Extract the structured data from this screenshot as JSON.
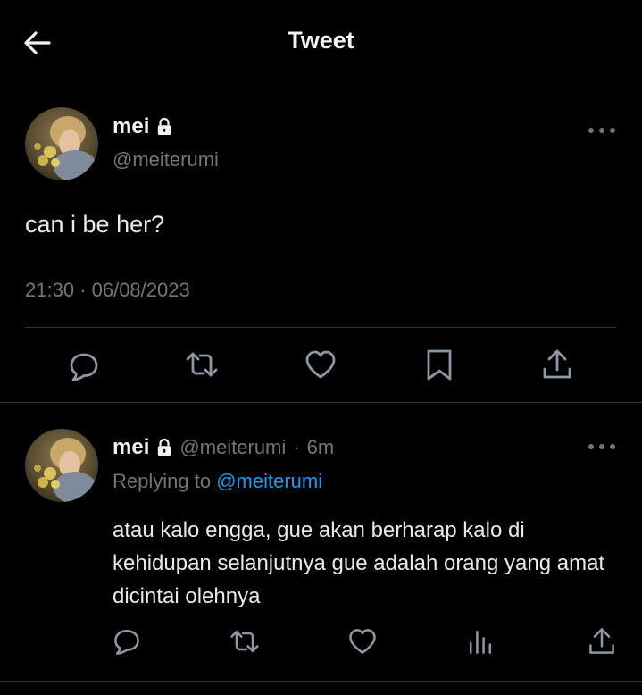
{
  "header": {
    "title": "Tweet",
    "back_icon": "arrow-left-icon"
  },
  "main_tweet": {
    "name": "mei",
    "lock_icon": "lock-icon",
    "handle": "@meiterumi",
    "text": "can i be her?",
    "timestamp": "21:30 · 06/08/2023",
    "actions": [
      "reply-icon",
      "retweet-icon",
      "like-icon",
      "bookmark-icon",
      "share-icon"
    ]
  },
  "reply_tweet": {
    "name": "mei",
    "handle": "@meiterumi",
    "separator": "·",
    "age": "6m",
    "replying_prefix": "Replying to",
    "replying_to": "@meiterumi",
    "text": "atau kalo engga, gue akan berharap kalo di kehidupan selanjutnya gue adalah orang yang amat dicintai olehnya",
    "actions": [
      "reply-icon",
      "retweet-icon",
      "like-icon",
      "analytics-icon",
      "share-icon"
    ]
  },
  "colors": {
    "background": "#000000",
    "text": "#e7e9ea",
    "muted": "#71767b",
    "link": "#1d9bf0",
    "divider": "#2f3336"
  }
}
